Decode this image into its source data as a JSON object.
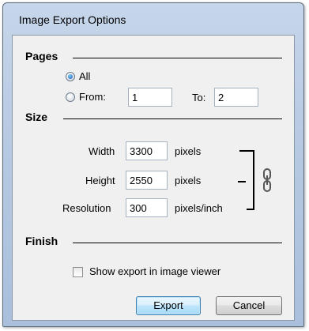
{
  "window": {
    "title": "Image Export Options"
  },
  "pages": {
    "section_title": "Pages",
    "all_label": "All",
    "from_label": "From:",
    "from_value": "1",
    "to_label": "To:",
    "to_value": "2",
    "selected": "All"
  },
  "size": {
    "section_title": "Size",
    "width_label": "Width",
    "width_value": "3300",
    "width_unit": "pixels",
    "height_label": "Height",
    "height_value": "2550",
    "height_unit": "pixels",
    "resolution_label": "Resolution",
    "resolution_value": "300",
    "resolution_unit": "pixels/inch",
    "link_icon": "chain-link-icon"
  },
  "finish": {
    "section_title": "Finish",
    "show_in_viewer_label": "Show export in image viewer",
    "show_in_viewer_checked": false
  },
  "buttons": {
    "export_label": "Export",
    "cancel_label": "Cancel"
  }
}
